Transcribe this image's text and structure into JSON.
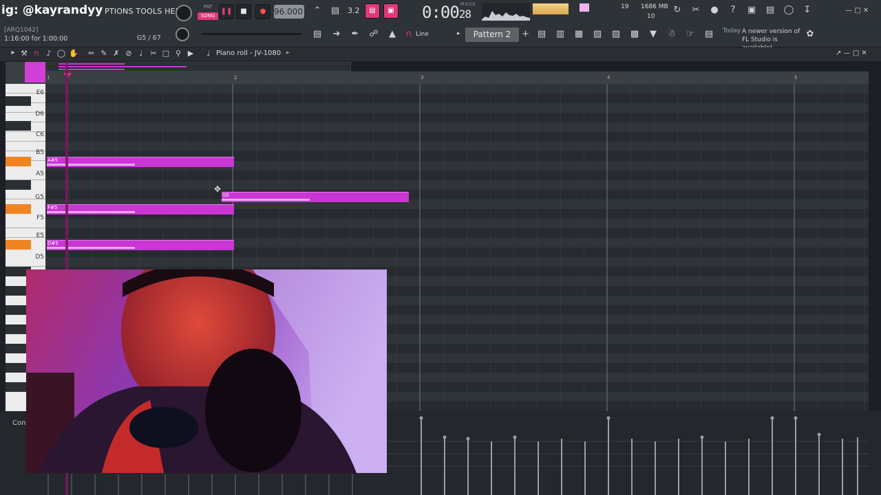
{
  "overlay": {
    "handle": "ig: @kayrandyy"
  },
  "menu": {
    "visible_text": "PTIONS TOOLS HELP"
  },
  "hint": {
    "line1": "[ARQ1042]",
    "line2": "1:16:00 for 1:00:00",
    "note": "G5 / 67"
  },
  "transport": {
    "pat_label": "PAT",
    "song_label": "SONG",
    "tempo": "96.000",
    "time_sig": "3.2",
    "clock_main": "0:00",
    "clock_sub": "28",
    "clock_unit": "M:S:CS"
  },
  "monitor": {
    "cpu": "19",
    "ram": "1686 MB",
    "polyphony": "10"
  },
  "toolbar": {
    "snap_label": "Line",
    "pattern_label": "Pattern 2"
  },
  "news": {
    "date": "Today",
    "text": "A newer version of FL Studio is available!"
  },
  "piano_roll": {
    "title": "Piano roll - JV-1080",
    "bars": [
      "1",
      "2",
      "3",
      "4",
      "5"
    ],
    "key_labels": [
      "E6",
      "D6",
      "C6",
      "B5",
      "A5",
      "G5",
      "F5",
      "E5",
      "D5"
    ],
    "notes": [
      {
        "label": "A#5"
      },
      {
        "label": "G5"
      },
      {
        "label": "F#5"
      },
      {
        "label": "D#5"
      }
    ]
  },
  "event_editor": {
    "label": "Con"
  },
  "colors": {
    "note": "#c936d4",
    "accent_orange": "#f08422",
    "song_pink": "#e0387a"
  }
}
